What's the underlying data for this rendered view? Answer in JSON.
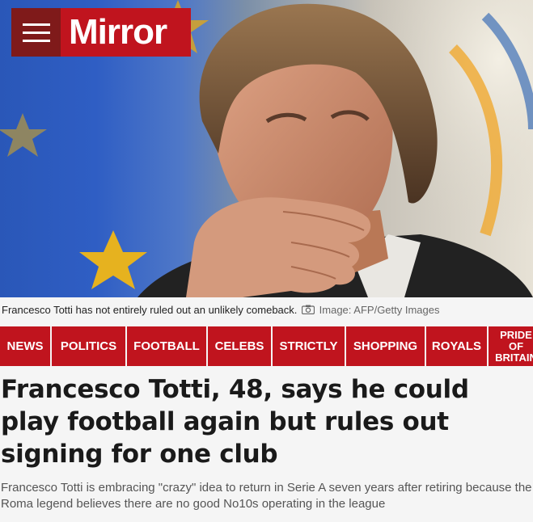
{
  "header": {
    "menu_icon": "hamburger-menu-icon",
    "logo_text": "Mirror",
    "brand_color": "#c0141e",
    "menu_color": "#7f1a1a"
  },
  "hero": {
    "description_icon": "photo"
  },
  "caption": {
    "text": "Francesco Totti has not entirely ruled out an unlikely comeback.",
    "camera_icon": "camera-icon",
    "credit": "Image: AFP/Getty Images"
  },
  "nav": {
    "items": [
      {
        "label": "NEWS"
      },
      {
        "label": "POLITICS"
      },
      {
        "label": "FOOTBALL"
      },
      {
        "label": "CELEBS"
      },
      {
        "label": "STRICTLY"
      },
      {
        "label": "SHOPPING"
      },
      {
        "label": "ROYALS"
      },
      {
        "label": "PRIDE OF BRITAIN"
      }
    ]
  },
  "article": {
    "headline": "Francesco Totti, 48, says he could play football again but rules out signing for one club",
    "standfirst": "Francesco Totti is embracing \"crazy\" idea to return in Serie A seven years after retiring because the Roma legend believes there are no good No10s operating in the league"
  }
}
